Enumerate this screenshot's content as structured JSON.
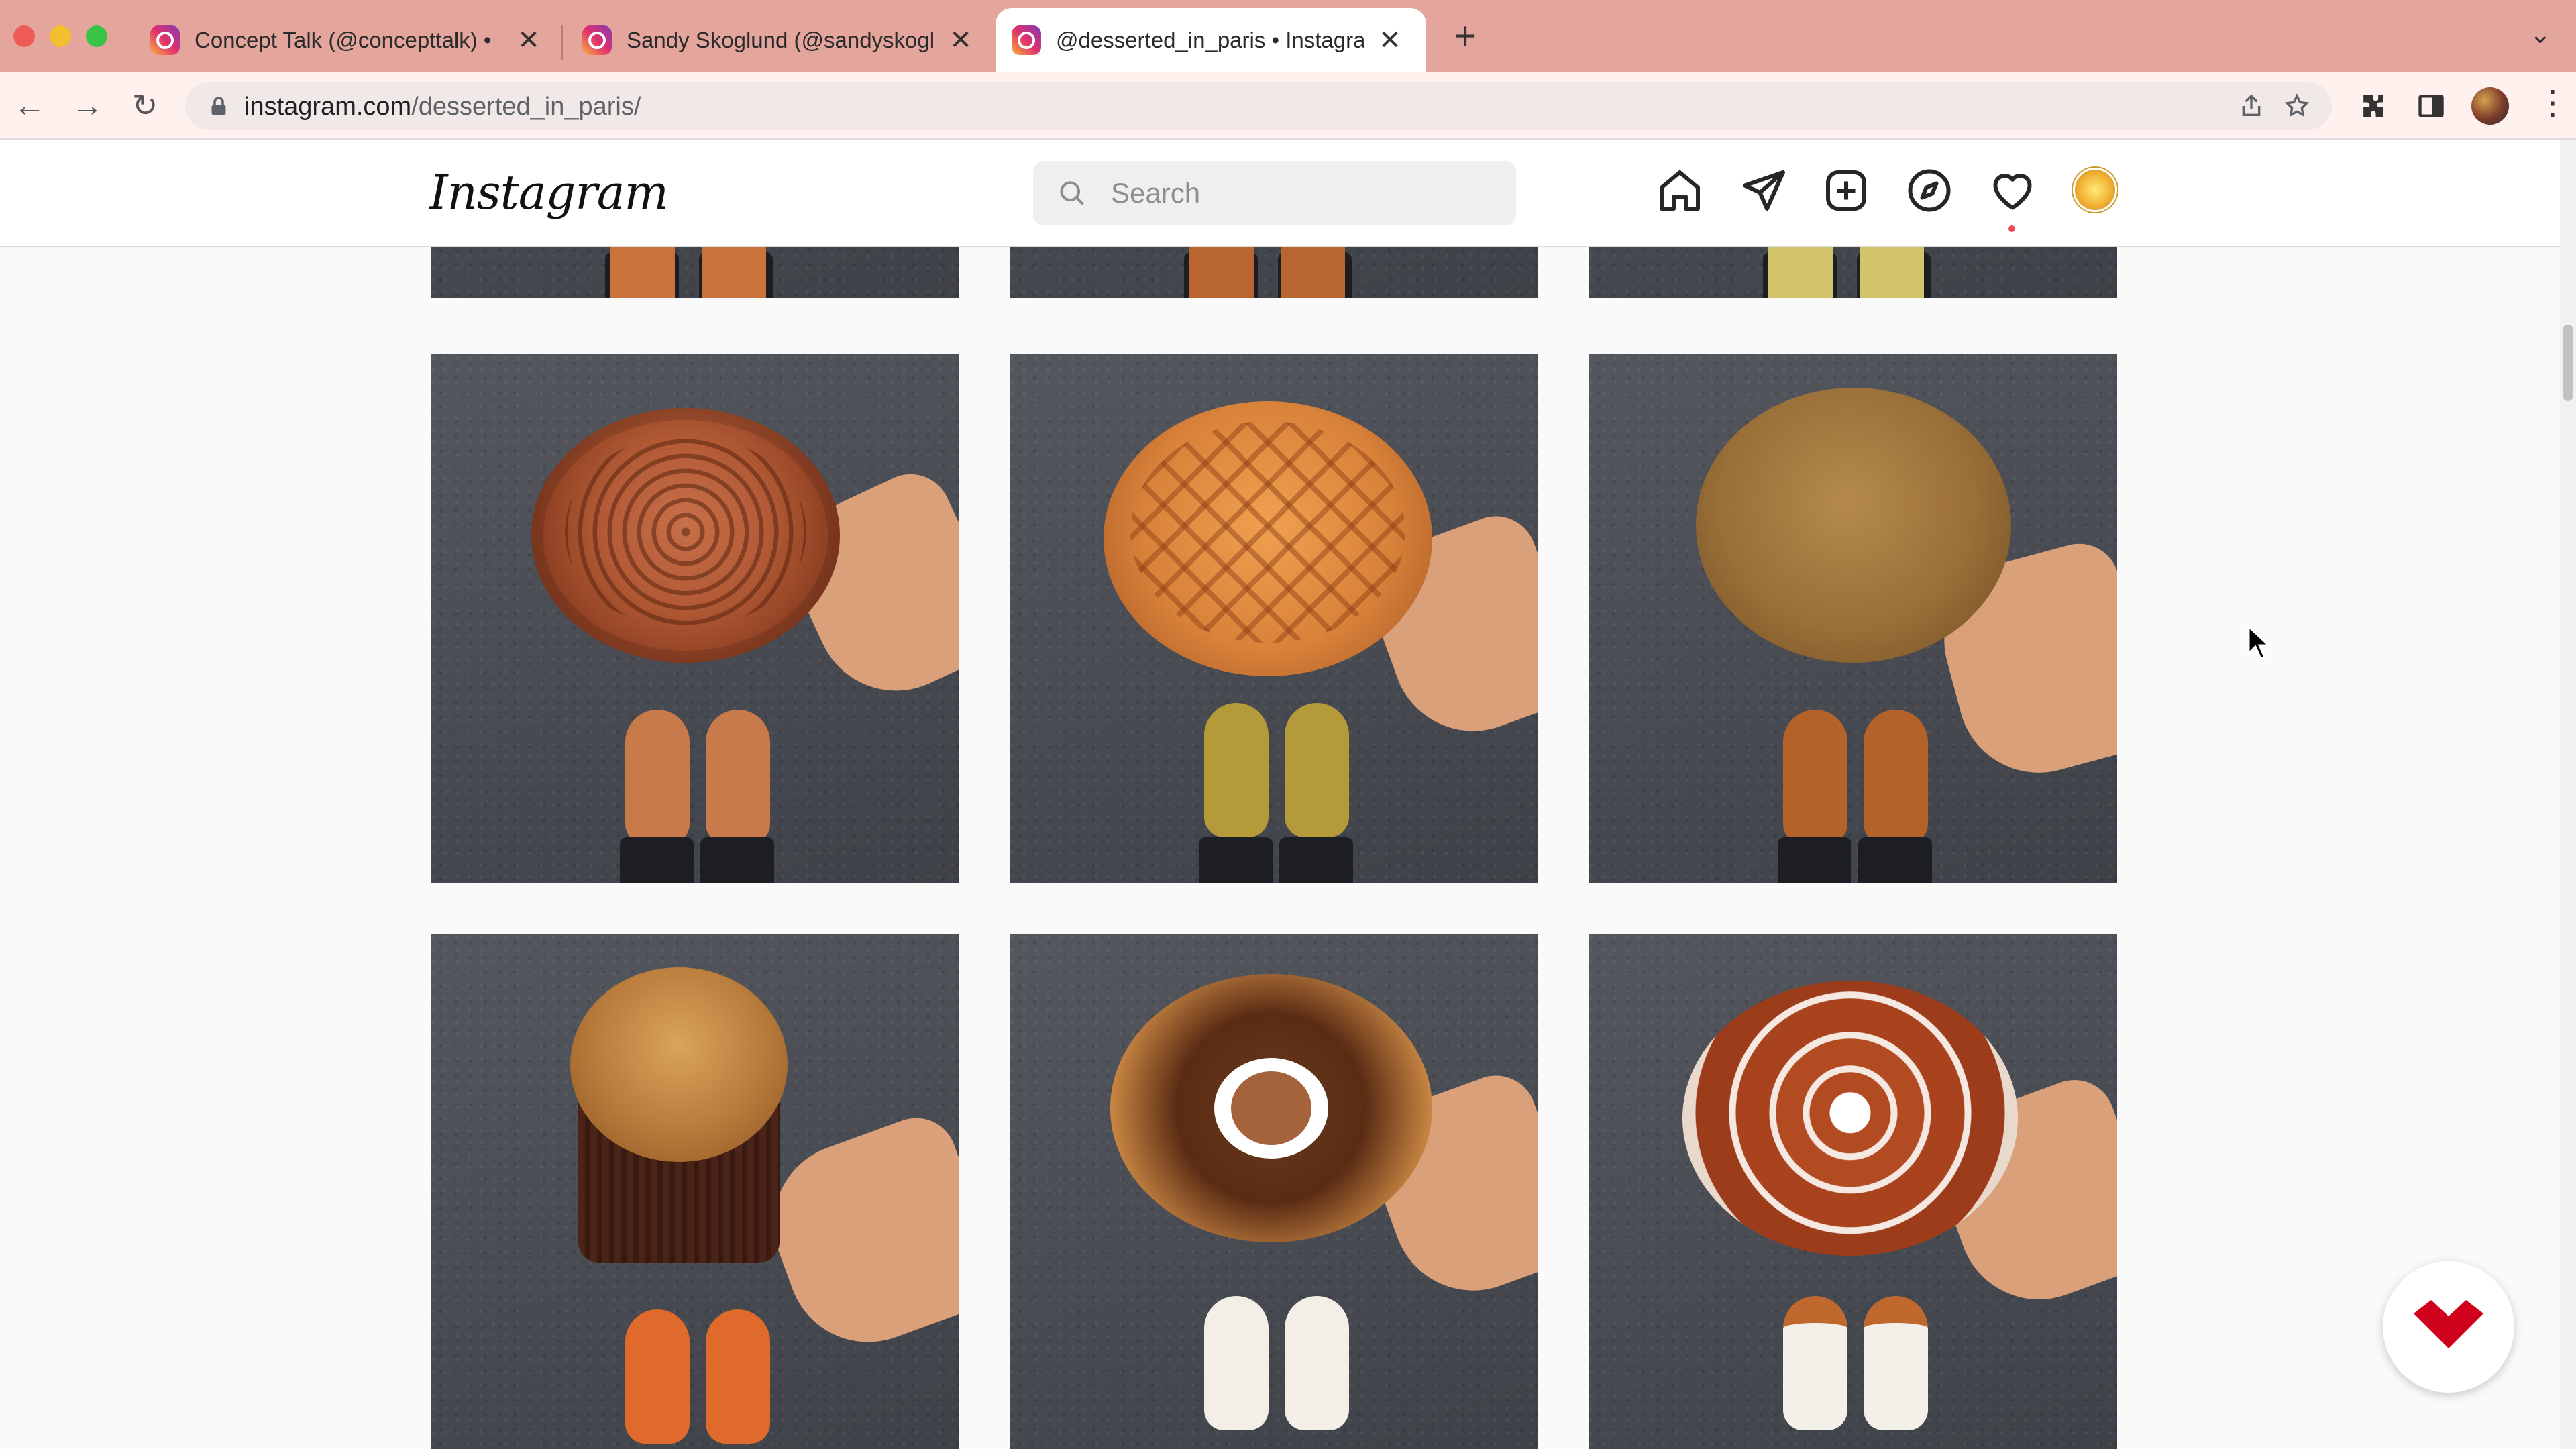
{
  "browser": {
    "tabs": [
      {
        "title": "Concept Talk (@concepttalk) •",
        "active": false
      },
      {
        "title": "Sandy Skoglund (@sandyskoglund",
        "active": false
      },
      {
        "title": "@desserted_in_paris • Instagram",
        "active": true
      }
    ],
    "close_glyph": "✕",
    "new_tab_glyph": "+",
    "tab_menu_glyph": "⌄",
    "url_host": "instagram.com",
    "url_path": "/desserted_in_paris/",
    "icons": [
      "back-icon",
      "forward-icon",
      "reload-icon",
      "lock-icon",
      "share-icon",
      "bookmark-star-icon",
      "extensions-icon",
      "side-panel-icon",
      "profile-avatar",
      "more-menu-icon"
    ]
  },
  "instagram": {
    "logo": "Instagram",
    "search_placeholder": "Search",
    "nav_icons": [
      "home-icon",
      "direct-messages-icon",
      "new-post-icon",
      "explore-icon",
      "activity-heart-icon",
      "profile-avatar"
    ],
    "notification_color": "#ed4956"
  },
  "feed": {
    "rows": [
      {
        "items": [
          "post-top-left",
          "post-top-middle",
          "post-top-right"
        ],
        "partial": true
      },
      {
        "items": [
          "lace-patterned-tart",
          "lattice-crust-tart",
          "round-crumb-cake"
        ]
      },
      {
        "items": [
          "panettone-in-brown-wrapper",
          "walnut-tart-with-coffee-center",
          "meringue-flower-tart"
        ]
      }
    ]
  },
  "colors": {
    "tab_bar": "#e3a59c",
    "address_bar": "#fff1ee",
    "badge_red": "#d0021b"
  }
}
